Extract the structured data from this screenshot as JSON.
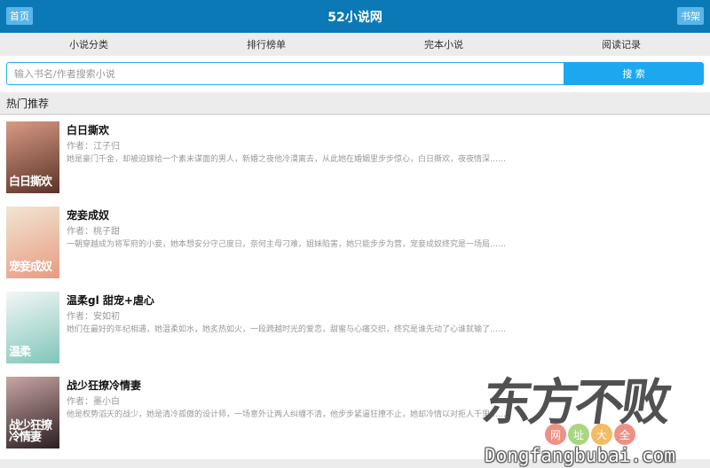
{
  "header": {
    "title": "52小说网",
    "left_button": "首页",
    "right_button": "书架"
  },
  "nav": {
    "items": [
      "小说分类",
      "排行榜单",
      "完本小说",
      "阅读记录"
    ]
  },
  "search": {
    "placeholder": "输入书名/作者搜索小说",
    "button_label": "搜 索"
  },
  "section": {
    "title": "热门推荐"
  },
  "books": [
    {
      "name": "白日撕欢",
      "author": "作者：江子归",
      "desc": "她是豪门千金，却被迫嫁给一个素未谋面的男人，新婚之夜他冷漠离去，从此她在婚姻里步步惊心，白日撕欢，夜夜情深……",
      "cover_text": "白日撕欢",
      "cover_colors": [
        "#d99a86",
        "#5a3226"
      ]
    },
    {
      "name": "宠妾成奴",
      "author": "作者：桃子甜",
      "desc": "一朝穿越成为将军府的小妾，她本想安分守己度日，奈何主母刁难，姐妹陷害，她只能步步为营，宠妾成奴终究是一场局……",
      "cover_text": "宠妾成奴",
      "cover_colors": [
        "#f1e6d2",
        "#e89a82"
      ]
    },
    {
      "name": "温柔gl 甜宠+虐心",
      "author": "作者：安如初",
      "desc": "她们在最好的年纪相遇，她温柔如水，她炙热如火，一段跨越时光的爱恋，甜蜜与心痛交织，终究是谁先动了心谁就输了……",
      "cover_text": "温柔",
      "cover_colors": [
        "#f4f6f7",
        "#7fc6b8"
      ]
    },
    {
      "name": "战少狂撩冷情妻",
      "author": "作者：墨小白",
      "desc": "他是权势滔天的战少，她是清冷孤傲的设计师，一场意外让两人纠缠不清，他步步紧逼狂撩不止，她却冷情以对拒人千里……",
      "cover_text": "战少狂撩冷情妻",
      "cover_colors": [
        "#c9a6a4",
        "#2a1e22"
      ]
    }
  ],
  "watermark": {
    "logo": "东方不败",
    "dots": [
      "网",
      "址",
      "大",
      "全"
    ],
    "dot_colors": [
      "#ea7e73",
      "#9ccf6a",
      "#f3b04b",
      "#ea7e73"
    ],
    "url": "Dongfangbubai.com"
  }
}
